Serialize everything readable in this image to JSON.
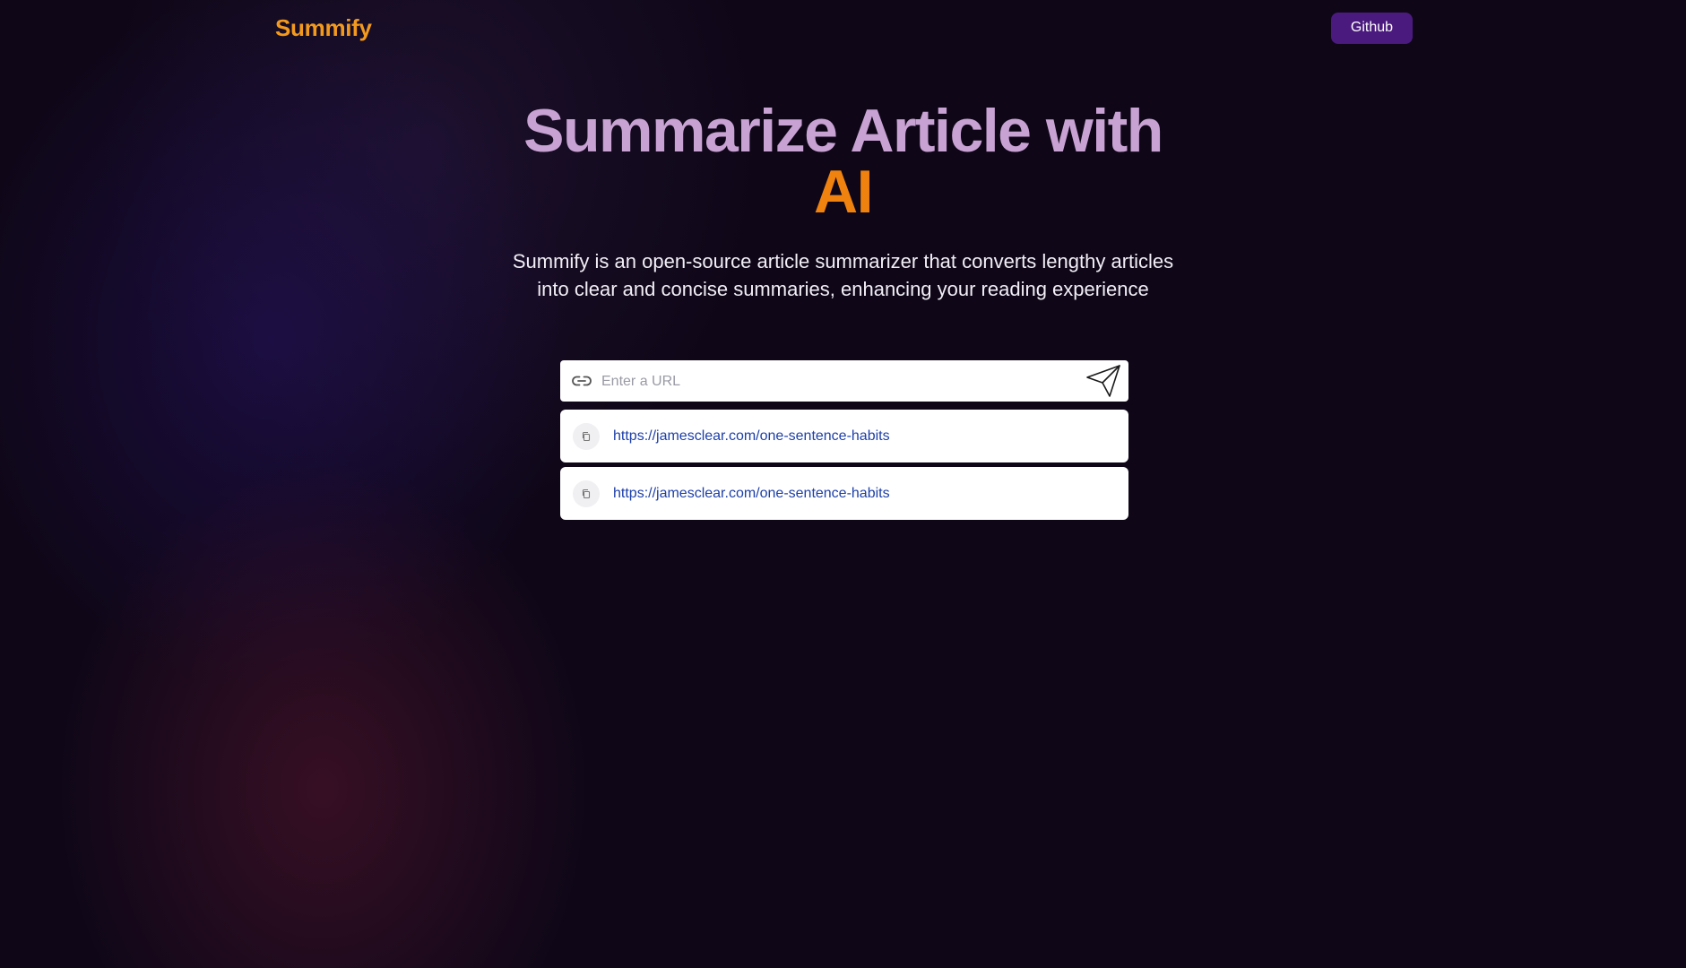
{
  "navbar": {
    "logo_text": "Summify",
    "github_label": "Github"
  },
  "hero": {
    "title_line1": "Summarize Article with",
    "title_highlight": "AI",
    "subtitle": "Summify is an open-source article summarizer that converts lengthy articles into clear and concise summaries, enhancing your reading experience"
  },
  "form": {
    "url_placeholder": "Enter a URL",
    "url_value": "",
    "link_icon": "link-icon",
    "submit_icon": "paper-plane-icon"
  },
  "history": {
    "items": [
      {
        "url": "https://jamesclear.com/one-sentence-habits",
        "icon": "copy-icon"
      },
      {
        "url": "https://jamesclear.com/one-sentence-habits",
        "icon": "copy-icon"
      }
    ]
  },
  "colors": {
    "background": "#0f0718",
    "brand_orange": "#f39a1e",
    "github_button": "#4a1a7e",
    "title_lilac": "#c8a2d3",
    "link_blue": "#1d3fa8"
  }
}
